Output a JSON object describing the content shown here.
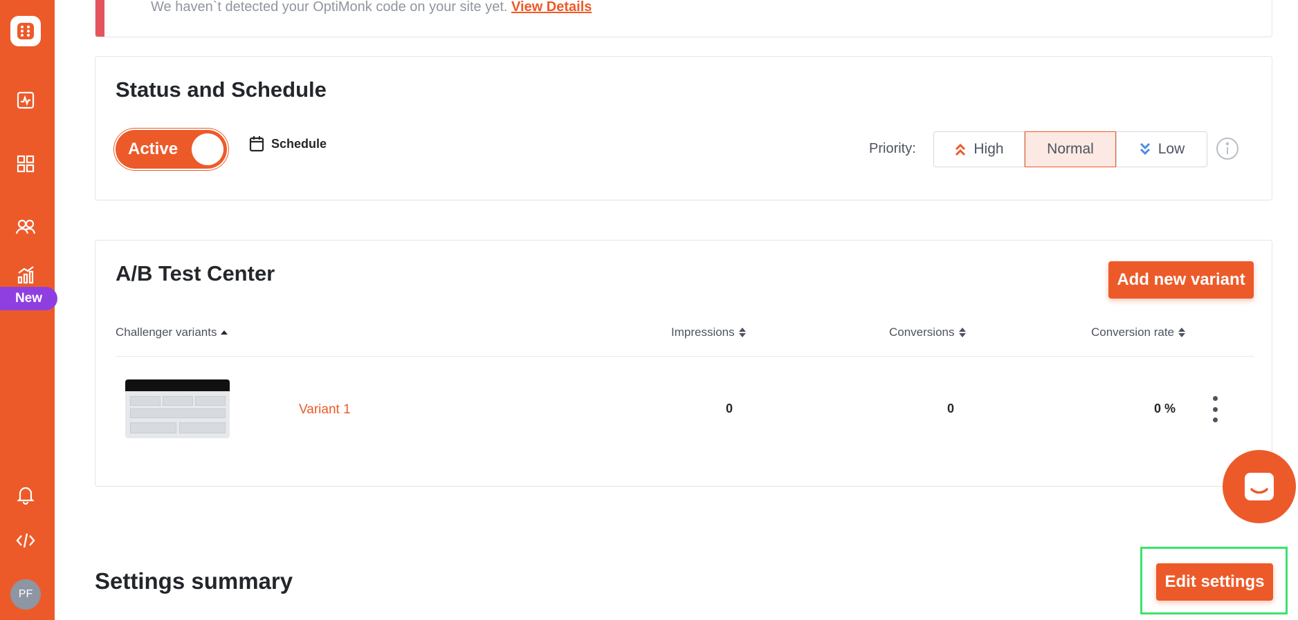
{
  "sidebar": {
    "icons": [
      "logo-icon",
      "analytics-icon",
      "campaigns-grid-icon",
      "subscribers-icon",
      "reports-icon",
      "notifications-bell-icon",
      "code-icon"
    ],
    "new_badge": "New",
    "avatar_initials": "PF",
    "accent": "#ed5a29"
  },
  "alert": {
    "message": "We haven`t detected your OptiMonk code on your site yet.",
    "link_label": "View Details",
    "color": "#e5555d"
  },
  "status": {
    "title": "Status and Schedule",
    "toggle_label": "Active",
    "toggle_on": true,
    "schedule_label": "Schedule",
    "priority_label": "Priority:",
    "priority_options": [
      "High",
      "Normal",
      "Low"
    ],
    "selected_priority": "Normal"
  },
  "ab_test": {
    "title": "A/B Test Center",
    "add_button": "Add new variant",
    "columns": {
      "variants": "Challenger variants",
      "impressions": "Impressions",
      "conversions": "Conversions",
      "rate": "Conversion rate"
    },
    "rows": [
      {
        "name": "Variant 1",
        "impressions": "0",
        "conversions": "0",
        "rate": "0 %"
      }
    ]
  },
  "settings": {
    "title": "Settings summary",
    "edit_button": "Edit settings"
  }
}
